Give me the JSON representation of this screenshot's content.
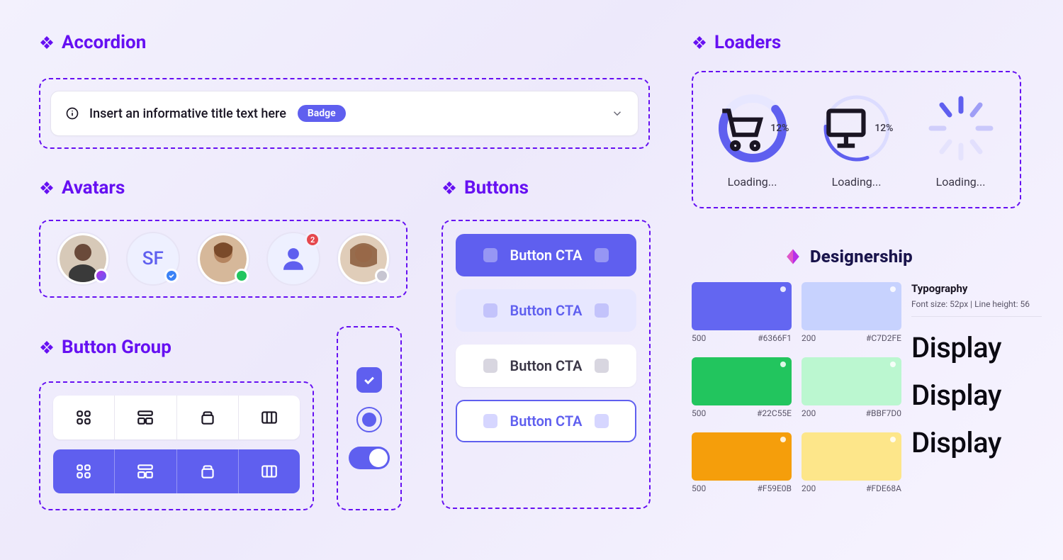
{
  "sections": {
    "accordion": "Accordion",
    "avatars": "Avatars",
    "buttons": "Buttons",
    "button_group": "Button Group",
    "loaders": "Loaders"
  },
  "accordion": {
    "title": "Insert an informative title text here",
    "badge": "Badge"
  },
  "avatars": {
    "initials": "SF",
    "notification_count": "2"
  },
  "buttons": {
    "cta": "Button CTA"
  },
  "loaders": {
    "percent": "12%",
    "label": "Loading..."
  },
  "brand": {
    "name": "Designership"
  },
  "colors": {
    "primary_500": {
      "shade": "500",
      "hex": "#6366F1"
    },
    "primary_200": {
      "shade": "200",
      "hex": "#C7D2FE"
    },
    "green_500": {
      "shade": "500",
      "hex": "#22C55E"
    },
    "green_200": {
      "shade": "200",
      "hex": "#BBF7D0"
    },
    "amber_500": {
      "shade": "500",
      "hex": "#F59E0B"
    },
    "amber_200": {
      "shade": "200",
      "hex": "#FDE68A"
    }
  },
  "typography": {
    "title": "Typography",
    "meta": "Font size: 52px | Line height: 56",
    "sample": "Display"
  }
}
